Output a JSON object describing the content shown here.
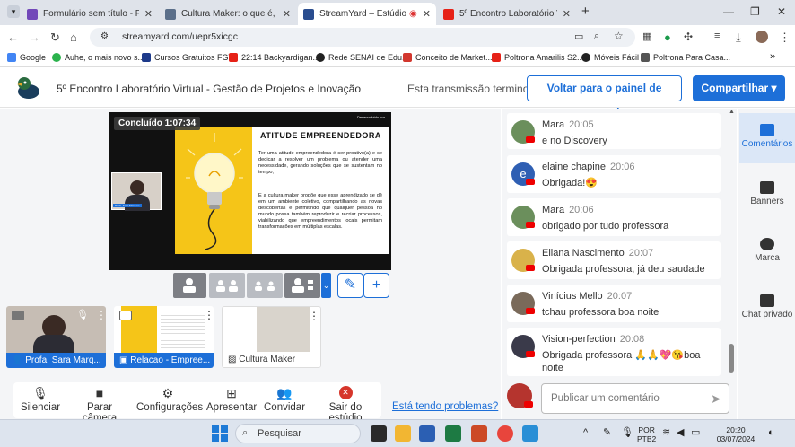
{
  "browser": {
    "tabs": [
      {
        "title": "Formulário sem título - Formulá",
        "icon_color": "#7248b9",
        "active": false
      },
      {
        "title": "Cultura Maker: o que é, import",
        "icon_color": "#5b6f8a",
        "active": false
      },
      {
        "title": "StreamYard – Estúdio",
        "icon_color": "#2a4d8f",
        "active": true
      },
      {
        "title": "5º Encontro Laboratório Virtual",
        "icon_color": "#e62117",
        "active": false
      }
    ],
    "url": "streamyard.com/uepr5xicgc",
    "bookmarks": [
      "Google",
      "Auhe, o mais novo s...",
      "Cursos Gratuitos FGV",
      "22:14 Backyardigan...",
      "Rede SENAI de Edu...",
      "Conceito de Market...",
      "Poltrona Amarilis S2...",
      "Móveis Fácil",
      "Poltrona Para Casa..."
    ]
  },
  "header": {
    "title": "5º Encontro Laboratório Virtual - Gestão de Projetos e Inovação",
    "status": "Esta transmissão terminou",
    "back_label": "Voltar para o painel de controle",
    "share_label": "Compartilhar"
  },
  "stage": {
    "status_badge": "Concluído 1:07:34",
    "slide": {
      "developed_by": "Desenvolvido por",
      "heading": "ATITUDE EMPREENDEDORA",
      "paragraph1": "Ter uma atitude empreendedora é ser proativo(a) e se dedicar a resolver um problema ou atender uma necessidade, gerando soluções que se sustentam no tempo;",
      "paragraph2": "E a cultura maker propõe que esse aprendizado se dê em um ambiente coletivo, compartilhando as novas descobertas e permitindo que qualquer pessoa no mundo possa também reproduzir e recriar processos, viabilizando que empreendimentos locais permitam transformações em múltiplas escalas.",
      "cam_name": "Profa. Sara Marques"
    }
  },
  "thumbnails": [
    {
      "label": "Profa. Sara Marq...",
      "bar_color": "#1d6fd8"
    },
    {
      "label": "Relacao - Empree...",
      "bar_color": "#1d6fd8"
    },
    {
      "label": "Cultura Maker",
      "bar_color": "#ffffff"
    }
  ],
  "toolbar": {
    "items": [
      {
        "label": "Silenciar",
        "icon": "microphone-icon"
      },
      {
        "label": "Parar câmera",
        "icon": "camera-icon"
      },
      {
        "label": "Configurações",
        "icon": "gear-icon"
      },
      {
        "label": "Apresentar",
        "icon": "present-icon"
      },
      {
        "label": "Convidar",
        "icon": "invite-icon"
      },
      {
        "label": "Sair do estúdio",
        "icon": "leave-icon"
      }
    ],
    "problems_link": "Está tendo problemas?"
  },
  "chat": {
    "messages": [
      {
        "name": "Mara",
        "time": "20:05",
        "text": "e no Discovery",
        "avatar_color": "#6b8f5c"
      },
      {
        "name": "elaine chapine",
        "time": "20:06",
        "text": "Obrigada!😍",
        "avatar_color": "#2f5fb3",
        "initial": "e"
      },
      {
        "name": "Mara",
        "time": "20:06",
        "text": "obrigado por tudo professora",
        "avatar_color": "#6b8f5c"
      },
      {
        "name": "Eliana Nascimento",
        "time": "20:07",
        "text": "Obrigada professora, já deu saudade",
        "avatar_color": "#d9b24a"
      },
      {
        "name": "Vinícius Mello",
        "time": "20:07",
        "text": "tchau professora boa noite",
        "avatar_color": "#7a6a5a"
      },
      {
        "name": "Vision-perfection",
        "time": "20:08",
        "text": "Obrigada professora 🙏🙏💖😘boa noite",
        "avatar_color": "#3a3a4a"
      }
    ],
    "composer_placeholder": "Publicar um comentário"
  },
  "side": {
    "items": [
      "Comentários",
      "Banners",
      "Marca",
      "Chat privado"
    ]
  },
  "taskbar": {
    "search_placeholder": "Pesquisar",
    "lang": "POR",
    "layout": "PTB2",
    "time": "20:20",
    "date": "03/07/2024"
  }
}
